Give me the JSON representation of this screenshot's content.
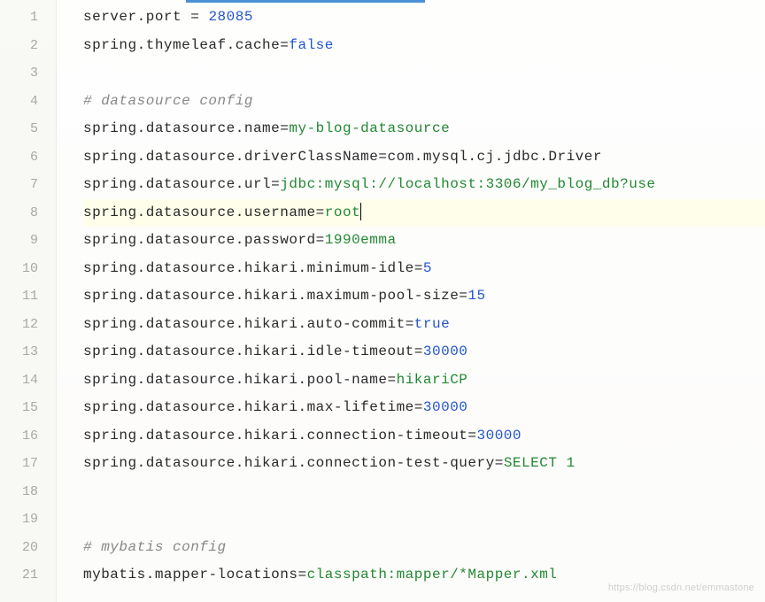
{
  "watermark": "https://blog.csdn.net/emmastone",
  "lines": [
    {
      "n": 1,
      "segments": [
        {
          "class": "prop-key",
          "t": "server"
        },
        {
          "class": "op",
          "t": "."
        },
        {
          "class": "prop-key",
          "t": "port"
        },
        {
          "class": "op",
          "t": " = "
        },
        {
          "class": "prop-val-num",
          "t": "28085"
        }
      ]
    },
    {
      "n": 2,
      "segments": [
        {
          "class": "prop-key",
          "t": "spring"
        },
        {
          "class": "op",
          "t": "."
        },
        {
          "class": "prop-key",
          "t": "thymeleaf"
        },
        {
          "class": "op",
          "t": "."
        },
        {
          "class": "prop-key",
          "t": "cache"
        },
        {
          "class": "op",
          "t": "="
        },
        {
          "class": "prop-val-keyword",
          "t": "false"
        }
      ]
    },
    {
      "n": 3,
      "segments": []
    },
    {
      "n": 4,
      "segments": [
        {
          "class": "comment",
          "t": "# datasource config"
        }
      ]
    },
    {
      "n": 5,
      "segments": [
        {
          "class": "prop-key",
          "t": "spring"
        },
        {
          "class": "op",
          "t": "."
        },
        {
          "class": "prop-key",
          "t": "datasource"
        },
        {
          "class": "op",
          "t": "."
        },
        {
          "class": "prop-key",
          "t": "name"
        },
        {
          "class": "op",
          "t": "="
        },
        {
          "class": "prop-val-str",
          "t": "my-blog-datasource"
        }
      ]
    },
    {
      "n": 6,
      "segments": [
        {
          "class": "prop-key",
          "t": "spring"
        },
        {
          "class": "op",
          "t": "."
        },
        {
          "class": "prop-key",
          "t": "datasource"
        },
        {
          "class": "op",
          "t": "."
        },
        {
          "class": "prop-key",
          "t": "driverClassName"
        },
        {
          "class": "op",
          "t": "="
        },
        {
          "class": "prop-key",
          "t": "com"
        },
        {
          "class": "op",
          "t": "."
        },
        {
          "class": "prop-key",
          "t": "mysql"
        },
        {
          "class": "op",
          "t": "."
        },
        {
          "class": "prop-key",
          "t": "cj"
        },
        {
          "class": "op",
          "t": "."
        },
        {
          "class": "prop-key",
          "t": "jdbc"
        },
        {
          "class": "op",
          "t": "."
        },
        {
          "class": "prop-key",
          "t": "Driver"
        }
      ]
    },
    {
      "n": 7,
      "segments": [
        {
          "class": "prop-key",
          "t": "spring"
        },
        {
          "class": "op",
          "t": "."
        },
        {
          "class": "prop-key",
          "t": "datasource"
        },
        {
          "class": "op",
          "t": "."
        },
        {
          "class": "prop-key",
          "t": "url"
        },
        {
          "class": "op",
          "t": "="
        },
        {
          "class": "prop-val-url",
          "t": "jdbc:mysql://localhost:3306/my_blog_db?use"
        }
      ]
    },
    {
      "n": 8,
      "active": true,
      "segments": [
        {
          "class": "prop-key",
          "t": "spring"
        },
        {
          "class": "op",
          "t": "."
        },
        {
          "class": "prop-key",
          "t": "datasource"
        },
        {
          "class": "op",
          "t": "."
        },
        {
          "class": "prop-key",
          "t": "username"
        },
        {
          "class": "op",
          "t": "="
        },
        {
          "class": "prop-val-str",
          "t": "root"
        }
      ],
      "cursor": true
    },
    {
      "n": 9,
      "segments": [
        {
          "class": "prop-key",
          "t": "spring"
        },
        {
          "class": "op",
          "t": "."
        },
        {
          "class": "prop-key",
          "t": "datasource"
        },
        {
          "class": "op",
          "t": "."
        },
        {
          "class": "prop-key",
          "t": "password"
        },
        {
          "class": "op",
          "t": "="
        },
        {
          "class": "prop-val-str",
          "t": "1990emma"
        }
      ]
    },
    {
      "n": 10,
      "segments": [
        {
          "class": "prop-key",
          "t": "spring"
        },
        {
          "class": "op",
          "t": "."
        },
        {
          "class": "prop-key",
          "t": "datasource"
        },
        {
          "class": "op",
          "t": "."
        },
        {
          "class": "prop-key",
          "t": "hikari"
        },
        {
          "class": "op",
          "t": "."
        },
        {
          "class": "prop-key",
          "t": "minimum-idle"
        },
        {
          "class": "op",
          "t": "="
        },
        {
          "class": "prop-val-num",
          "t": "5"
        }
      ]
    },
    {
      "n": 11,
      "segments": [
        {
          "class": "prop-key",
          "t": "spring"
        },
        {
          "class": "op",
          "t": "."
        },
        {
          "class": "prop-key",
          "t": "datasource"
        },
        {
          "class": "op",
          "t": "."
        },
        {
          "class": "prop-key",
          "t": "hikari"
        },
        {
          "class": "op",
          "t": "."
        },
        {
          "class": "prop-key",
          "t": "maximum-pool-size"
        },
        {
          "class": "op",
          "t": "="
        },
        {
          "class": "prop-val-num",
          "t": "15"
        }
      ]
    },
    {
      "n": 12,
      "segments": [
        {
          "class": "prop-key",
          "t": "spring"
        },
        {
          "class": "op",
          "t": "."
        },
        {
          "class": "prop-key",
          "t": "datasource"
        },
        {
          "class": "op",
          "t": "."
        },
        {
          "class": "prop-key",
          "t": "hikari"
        },
        {
          "class": "op",
          "t": "."
        },
        {
          "class": "prop-key",
          "t": "auto-commit"
        },
        {
          "class": "op",
          "t": "="
        },
        {
          "class": "prop-val-keyword",
          "t": "true"
        }
      ]
    },
    {
      "n": 13,
      "segments": [
        {
          "class": "prop-key",
          "t": "spring"
        },
        {
          "class": "op",
          "t": "."
        },
        {
          "class": "prop-key",
          "t": "datasource"
        },
        {
          "class": "op",
          "t": "."
        },
        {
          "class": "prop-key",
          "t": "hikari"
        },
        {
          "class": "op",
          "t": "."
        },
        {
          "class": "prop-key",
          "t": "idle-timeout"
        },
        {
          "class": "op",
          "t": "="
        },
        {
          "class": "prop-val-num",
          "t": "30000"
        }
      ]
    },
    {
      "n": 14,
      "segments": [
        {
          "class": "prop-key",
          "t": "spring"
        },
        {
          "class": "op",
          "t": "."
        },
        {
          "class": "prop-key",
          "t": "datasource"
        },
        {
          "class": "op",
          "t": "."
        },
        {
          "class": "prop-key",
          "t": "hikari"
        },
        {
          "class": "op",
          "t": "."
        },
        {
          "class": "prop-key",
          "t": "pool-name"
        },
        {
          "class": "op",
          "t": "="
        },
        {
          "class": "prop-val-str",
          "t": "hikariCP"
        }
      ]
    },
    {
      "n": 15,
      "segments": [
        {
          "class": "prop-key",
          "t": "spring"
        },
        {
          "class": "op",
          "t": "."
        },
        {
          "class": "prop-key",
          "t": "datasource"
        },
        {
          "class": "op",
          "t": "."
        },
        {
          "class": "prop-key",
          "t": "hikari"
        },
        {
          "class": "op",
          "t": "."
        },
        {
          "class": "prop-key",
          "t": "max-lifetime"
        },
        {
          "class": "op",
          "t": "="
        },
        {
          "class": "prop-val-num",
          "t": "30000"
        }
      ]
    },
    {
      "n": 16,
      "segments": [
        {
          "class": "prop-key",
          "t": "spring"
        },
        {
          "class": "op",
          "t": "."
        },
        {
          "class": "prop-key",
          "t": "datasource"
        },
        {
          "class": "op",
          "t": "."
        },
        {
          "class": "prop-key",
          "t": "hikari"
        },
        {
          "class": "op",
          "t": "."
        },
        {
          "class": "prop-key",
          "t": "connection-timeout"
        },
        {
          "class": "op",
          "t": "="
        },
        {
          "class": "prop-val-num",
          "t": "30000"
        }
      ]
    },
    {
      "n": 17,
      "segments": [
        {
          "class": "prop-key",
          "t": "spring"
        },
        {
          "class": "op",
          "t": "."
        },
        {
          "class": "prop-key",
          "t": "datasource"
        },
        {
          "class": "op",
          "t": "."
        },
        {
          "class": "prop-key",
          "t": "hikari"
        },
        {
          "class": "op",
          "t": "."
        },
        {
          "class": "prop-key",
          "t": "connection-test-query"
        },
        {
          "class": "op",
          "t": "="
        },
        {
          "class": "prop-val-str",
          "t": "SELECT 1"
        }
      ]
    },
    {
      "n": 18,
      "segments": []
    },
    {
      "n": 19,
      "segments": []
    },
    {
      "n": 20,
      "segments": [
        {
          "class": "comment",
          "t": "# mybatis config"
        }
      ]
    },
    {
      "n": 21,
      "segments": [
        {
          "class": "prop-key",
          "t": "mybatis"
        },
        {
          "class": "op",
          "t": "."
        },
        {
          "class": "prop-key",
          "t": "mapper-locations"
        },
        {
          "class": "op",
          "t": "="
        },
        {
          "class": "prop-val-str",
          "t": "classpath:mapper/*Mapper.xml"
        }
      ]
    }
  ]
}
